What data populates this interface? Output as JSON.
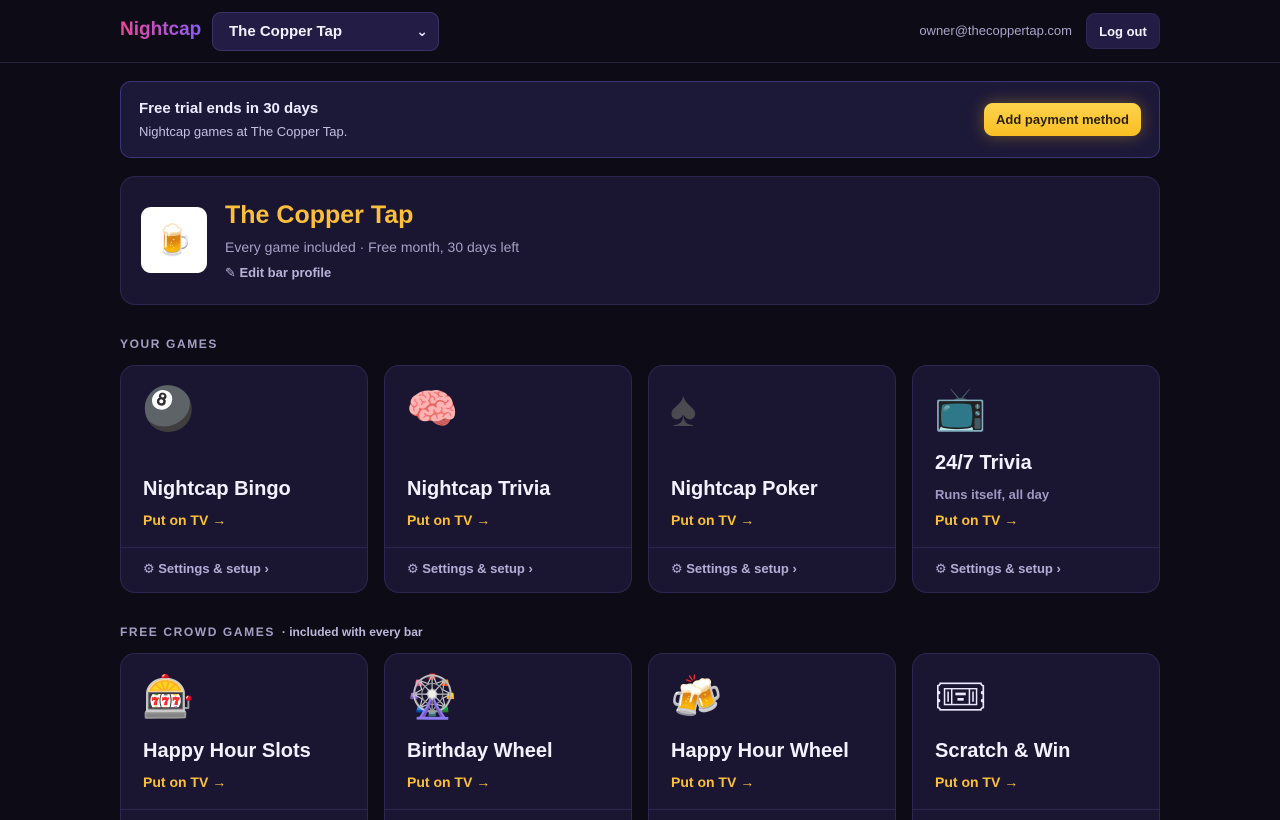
{
  "header": {
    "brand": "Nightcap",
    "venue_selected": "The Copper Tap",
    "user_email": "owner@thecoppertap.com",
    "logout_label": "Log out"
  },
  "trial": {
    "title": "Free trial ends in 30 days",
    "subtitle": "Nightcap games at The Copper Tap.",
    "action_label": "Add payment method"
  },
  "profile": {
    "logo_icon": "🍺",
    "name": "The Copper Tap",
    "meta": "Every game included · Free month, 30 days left",
    "edit_label": "✎ Edit bar profile"
  },
  "your_games": {
    "heading": "YOUR GAMES",
    "cards": [
      {
        "icon": "🎱",
        "icon_name": "pool-ball-icon",
        "title": "Nightcap Bingo",
        "desc": "",
        "cta": "Put on TV →",
        "setup": "⚙ Settings & setup ›"
      },
      {
        "icon": "🧠",
        "icon_name": "brain-icon",
        "title": "Nightcap Trivia",
        "desc": "",
        "cta": "Put on TV →",
        "setup": "⚙ Settings & setup ›"
      },
      {
        "icon": "♠",
        "icon_name": "spade-icon",
        "title": "Nightcap Poker",
        "desc": "",
        "cta": "Put on TV →",
        "setup": "⚙ Settings & setup ›"
      },
      {
        "icon": "📺",
        "icon_name": "tv-icon",
        "title": "24/7 Trivia",
        "desc": "Runs itself, all day",
        "cta": "Put on TV →",
        "setup": "⚙ Settings & setup ›"
      }
    ]
  },
  "crowd_games": {
    "heading": "FREE CROWD GAMES",
    "note": "· included with every bar",
    "cards": [
      {
        "icon": "🎰",
        "icon_name": "slot-machine-icon",
        "title": "Happy Hour Slots",
        "cta": "Put on TV →"
      },
      {
        "icon": "🎡",
        "icon_name": "ferris-wheel-icon",
        "title": "Birthday Wheel",
        "cta": "Put on TV →"
      },
      {
        "icon": "🍻",
        "icon_name": "beers-icon",
        "title": "Happy Hour Wheel",
        "cta": "Put on TV →"
      },
      {
        "icon": "🎟",
        "icon_name": "ticket-icon",
        "title": "Scratch & Win",
        "cta": "Put on TV →"
      }
    ]
  }
}
